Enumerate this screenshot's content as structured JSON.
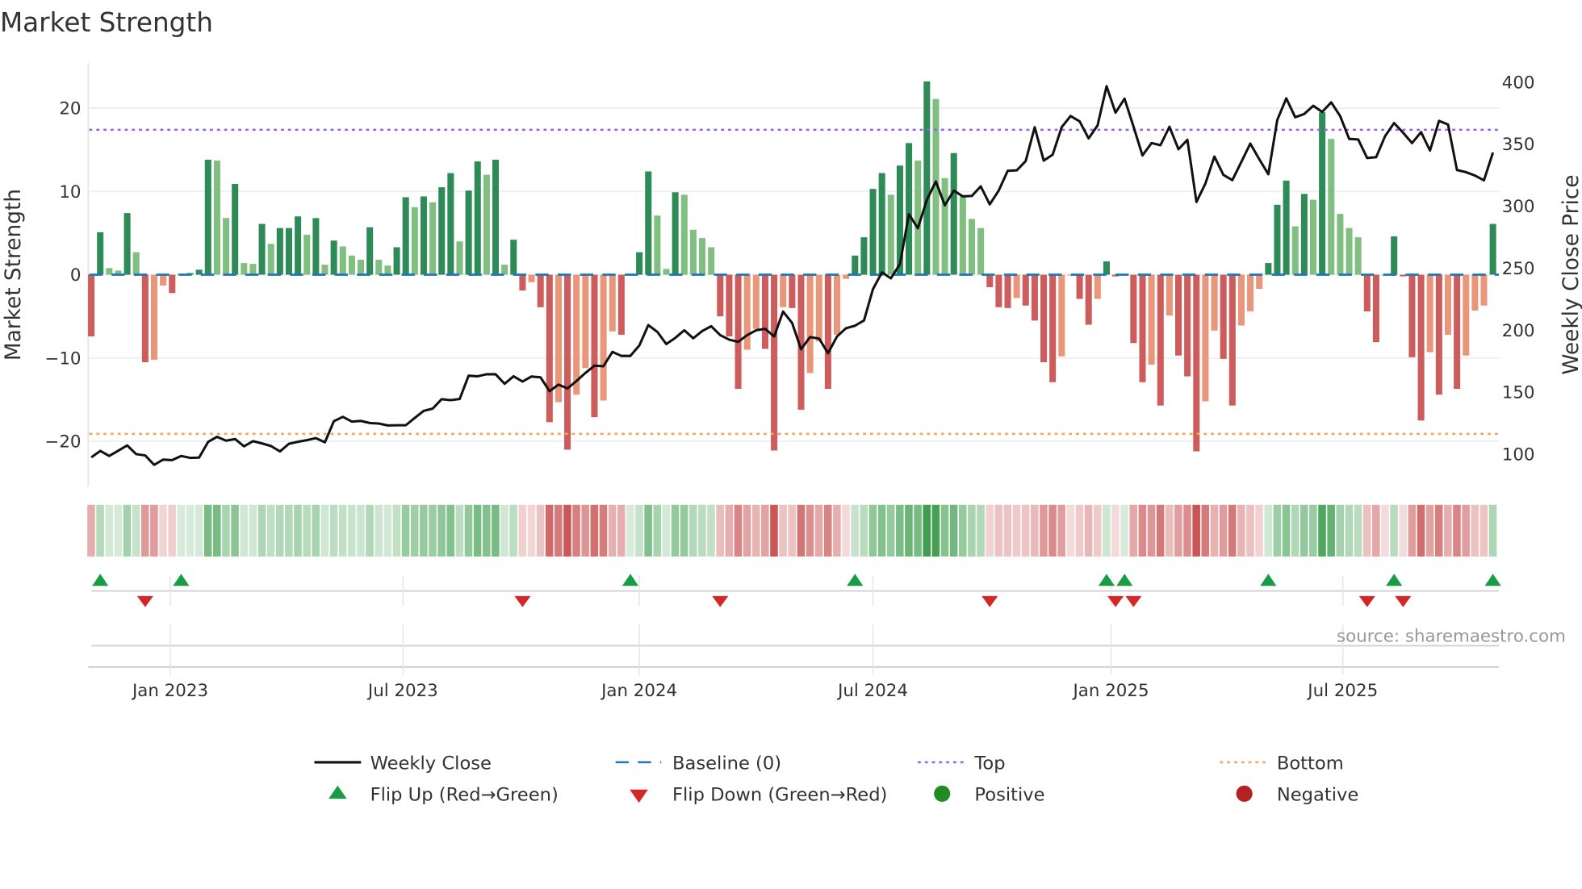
{
  "chart_data": {
    "type": "bar",
    "title": "Market Strength",
    "ylabel": "Market Strength",
    "y2label": "Weekly Close Price",
    "ylim": [
      -25.5,
      25.7
    ],
    "y2lim": [
      73,
      424
    ],
    "yticks": [
      "20",
      "10",
      "0",
      "−10",
      "−20"
    ],
    "ytick_values": [
      20,
      10,
      0,
      -10,
      -20
    ],
    "y2ticks": [
      "400",
      "350",
      "300",
      "250",
      "200",
      "150",
      "100"
    ],
    "y2tick_values": [
      400,
      350,
      300,
      250,
      200,
      150,
      100
    ],
    "xticks": [
      "Jan 2023",
      "Jul 2023",
      "Jan 2024",
      "Jul 2024",
      "Jan 2025",
      "Jul 2025"
    ],
    "xtick_weeks": [
      8.8,
      34.7,
      61,
      87,
      113.5,
      139.3
    ],
    "top_level": 17.4,
    "bottom_level": -19.1,
    "baseline": 0,
    "grid": true,
    "legend_position": "bottom-center",
    "source": "source: sharemaestro.com",
    "series": [
      {
        "name": "Market Strength",
        "kind": "bar",
        "values": [
          -7.4,
          5.1,
          0.8,
          0.5,
          7.4,
          2.7,
          -10.5,
          -10.2,
          -1.3,
          -2.2,
          0.1,
          0.2,
          0.6,
          13.8,
          13.7,
          6.8,
          10.9,
          1.4,
          1.3,
          6.1,
          3.7,
          5.6,
          5.6,
          7.0,
          4.8,
          6.8,
          1.2,
          4.1,
          3.4,
          2.3,
          1.8,
          5.7,
          1.8,
          1.1,
          3.3,
          9.3,
          8.1,
          9.4,
          8.7,
          10.5,
          12.2,
          4.0,
          10.1,
          13.6,
          12.0,
          13.8,
          1.2,
          4.2,
          -1.9,
          -0.9,
          -3.9,
          -17.7,
          -15.3,
          -21.0,
          -14.4,
          -11.2,
          -17.1,
          -15.1,
          -6.8,
          -7.2,
          0.1,
          2.7,
          12.4,
          7.1,
          0.7,
          9.9,
          9.6,
          5.4,
          4.4,
          3.3,
          -5.0,
          -7.4,
          -13.7,
          -9.0,
          -6.5,
          -8.9,
          -21.1,
          -3.9,
          -4.0,
          -16.2,
          -11.8,
          -8.0,
          -13.7,
          -7.2,
          -0.5,
          2.3,
          4.5,
          10.3,
          12.2,
          9.6,
          13.1,
          15.8,
          13.7,
          23.2,
          21.1,
          11.6,
          14.6,
          9.4,
          6.7,
          5.6,
          -1.5,
          -3.9,
          -4.0,
          -2.8,
          -3.7,
          -5.5,
          -10.5,
          -12.9,
          -9.8,
          -0.1,
          -2.9,
          -6.0,
          -2.9,
          1.6,
          -0.2,
          0.1,
          -8.2,
          -12.9,
          -10.8,
          -15.7,
          -4.9,
          -9.7,
          -12.2,
          -21.2,
          -15.2,
          -6.7,
          -10.1,
          -15.7,
          -6.1,
          -4.4,
          -1.7,
          1.4,
          8.4,
          11.3,
          5.8,
          9.7,
          9.0,
          19.5,
          16.3,
          7.3,
          5.6,
          4.5,
          -4.4,
          -8.1,
          -0.1,
          4.6,
          -0.2,
          -9.9,
          -17.5,
          -9.3,
          -14.4,
          -7.2,
          -13.7,
          -9.7,
          -4.3,
          -3.7,
          6.1
        ]
      },
      {
        "name": "Weekly Close",
        "kind": "line",
        "axis": "right",
        "values": [
          97.4,
          102.6,
          98.5,
          102.8,
          107,
          100,
          98.9,
          91.3,
          95.6,
          95.2,
          98.5,
          97,
          97.2,
          109.8,
          114,
          110.9,
          112.2,
          106.3,
          110.5,
          108.7,
          106.5,
          102.2,
          108.3,
          110,
          111.3,
          112.9,
          109.6,
          126.6,
          130.1,
          126.2,
          126.8,
          125.1,
          124.7,
          123.1,
          123.3,
          123.3,
          129.2,
          134.9,
          136.7,
          144.3,
          143.6,
          144.5,
          163.3,
          162.8,
          164.4,
          164.4,
          156.7,
          162.8,
          158.5,
          162.6,
          162,
          150.8,
          156.1,
          153,
          158.9,
          165.5,
          171.4,
          170.9,
          182.5,
          179.2,
          179.2,
          187.7,
          204.1,
          198.6,
          188.8,
          193.8,
          199.9,
          193.4,
          199.3,
          203.2,
          196,
          192.3,
          190.6,
          196,
          199.9,
          201,
          194.9,
          215,
          205.8,
          184.6,
          194.4,
          193.2,
          181.4,
          194.9,
          201.5,
          203.6,
          207.8,
          233.1,
          246.6,
          241.8,
          253.2,
          293.5,
          282.2,
          305.1,
          319.9,
          300.7,
          312.5,
          307.9,
          308.2,
          316,
          301.4,
          312.7,
          328.5,
          328.9,
          336.3,
          363.6,
          336.7,
          341.5,
          363.6,
          372.7,
          368.4,
          354.6,
          365.1,
          396.7,
          375.4,
          386.7,
          364,
          340.9,
          350.9,
          349.2,
          364,
          345.9,
          353.5,
          303.4,
          318.2,
          340,
          325.2,
          321,
          335.7,
          350.5,
          337.8,
          325.8,
          369.5,
          386.9,
          371.7,
          374.3,
          381,
          376,
          383.7,
          372.7,
          354.2,
          353.8,
          338.9,
          339.4,
          356.4,
          367.1,
          359.2,
          350.9,
          359.7,
          344.8,
          368.8,
          365.8,
          329.1,
          327.4,
          324.7,
          320.8,
          343.3
        ]
      }
    ]
  },
  "legend": {
    "weekly_close": "Weekly Close",
    "baseline": "Baseline (0)",
    "top": "Top",
    "bottom": "Bottom",
    "flip_up": "Flip Up (Red→Green)",
    "flip_down": "Flip Down (Green→Red)",
    "positive": "Positive",
    "negative": "Negative"
  },
  "colors": {
    "rise_green": "#2e8b57",
    "fall_green": "#80bf80",
    "fall_red": "#cd5c5c",
    "rise_red": "#e9967a",
    "line": "#111111",
    "baseline": "#1f77b4",
    "top": "#9b5de5",
    "bottom": "#f4a460",
    "flip_up": "#1a9c47",
    "flip_down": "#d62728",
    "positive": "#228b22",
    "negative": "#b22222"
  }
}
